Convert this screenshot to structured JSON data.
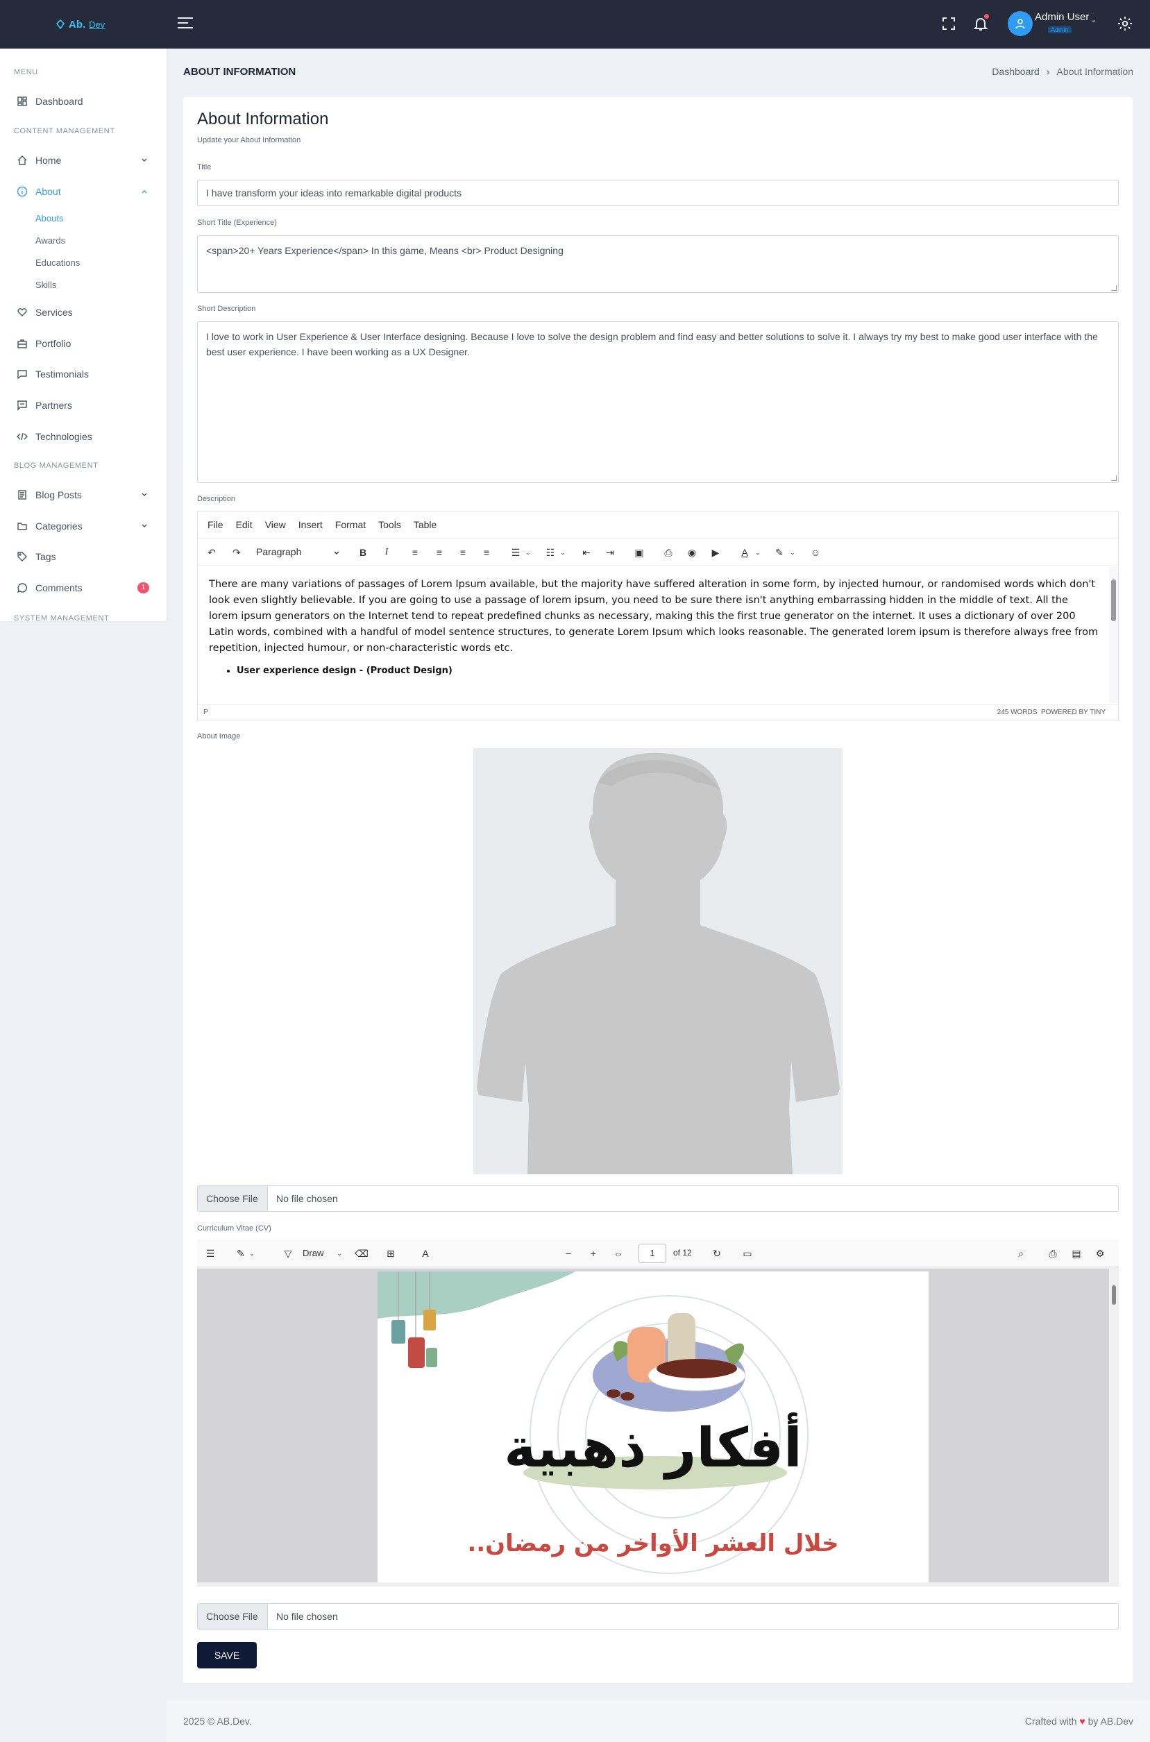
{
  "header": {
    "logo_text": "Ab.",
    "logo_suffix": "Dev",
    "user_name": "Admin User",
    "user_role": "Admin",
    "icons": [
      "menu-icon",
      "fullscreen-icon",
      "bell-icon",
      "user-icon",
      "gear-icon"
    ]
  },
  "sidebar": {
    "section_menu": "MENU",
    "section_content": "CONTENT MANAGEMENT",
    "section_blog": "BLOG MANAGEMENT",
    "section_system": "SYSTEM MANAGEMENT",
    "items": {
      "dashboard": "Dashboard",
      "home": "Home",
      "about": "About",
      "abouts": "Abouts",
      "awards": "Awards",
      "educations": "Educations",
      "skills": "Skills",
      "services": "Services",
      "portfolio": "Portfolio",
      "testimonials": "Testimonials",
      "partners": "Partners",
      "technologies": "Technologies",
      "blog_posts": "Blog Posts",
      "categories": "Categories",
      "tags": "Tags",
      "comments": "Comments"
    },
    "comments_badge": "1",
    "accent_color": "#2f9cf4"
  },
  "page": {
    "title": "ABOUT INFORMATION",
    "breadcrumb_home": "Dashboard",
    "breadcrumb_sep": "›",
    "breadcrumb_current": "About Information"
  },
  "form": {
    "heading": "About Information",
    "subheading": "Update your About Information",
    "title_label": "Title",
    "title_value": "I have transform your ideas into remarkable digital products",
    "short_title_label": "Short Title (Experience)",
    "short_title_value": "<span>20+ Years Experience</span> In this game, Means <br> Product Designing",
    "short_desc_label": "Short Description",
    "short_desc_value": "I love to work in User Experience & User Interface designing. Because I love to solve the design problem and find easy and better solutions to solve it. I always try my best to make good user interface with the best user experience. I have been working as a UX Designer.",
    "desc_label": "Description",
    "editor_menu": [
      "File",
      "Edit",
      "View",
      "Insert",
      "Format",
      "Tools",
      "Table"
    ],
    "editor_block_format": "Paragraph",
    "editor_body": "There are many variations of passages of Lorem Ipsum available, but the majority have suffered alteration in some form, by injected humour, or randomised words which don't look even slightly believable. If you are going to use a passage of lorem ipsum, you need to be sure there isn't anything embarrassing hidden in the middle of text. All the lorem ipsum generators on the Internet tend to repeat predefined chunks as necessary, making this the first true generator on the internet. It uses a dictionary of over 200 Latin words, combined with a handful of model sentence structures, to generate Lorem Ipsum which looks reasonable. The generated lorem ipsum is therefore always free from repetition, injected humour, or non-characteristic words etc.",
    "editor_bullet": "User experience design",
    "editor_bullet_note": " - (Product Design)",
    "editor_status_path": "P",
    "editor_word_count": "245 WORDS",
    "editor_powered": "POWERED BY TINY",
    "image_label": "About Image",
    "file_choose": "Choose File",
    "file_none": "No file chosen",
    "cv_label": "Curriculum Vitae (CV)",
    "pdf_draw": "Draw",
    "pdf_page": "1",
    "pdf_of": "of 12",
    "pdf_arabic_title": "أفكار ذهبية",
    "pdf_arabic_subtitle": "خلال العشر الأواخر من رمضان..",
    "save_label": "SAVE"
  },
  "footer": {
    "left": "2025 © AB.Dev.",
    "right_pre": "Crafted with ",
    "right_post": " by AB.Dev"
  }
}
